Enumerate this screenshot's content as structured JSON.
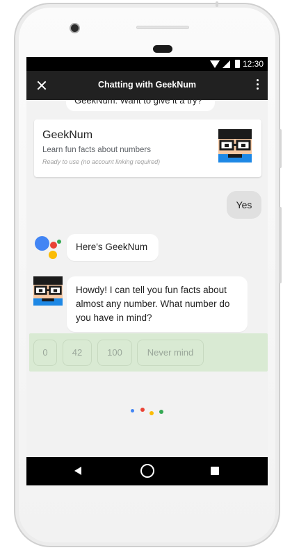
{
  "status_bar": {
    "time": "12:30"
  },
  "app_bar": {
    "title": "Chatting with GeekNum"
  },
  "messages": {
    "previous_bot_partial": "GeekNum: Want to give it a try?",
    "user_reply": "Yes",
    "assistant_intro": "Here's GeekNum",
    "bot_greeting": "Howdy! I can tell you fun facts about almost any number. What number do you have in mind?"
  },
  "app_card": {
    "name": "GeekNum",
    "description": "Learn fun facts about numbers",
    "status": "Ready to use (no account linking required)"
  },
  "suggestions": [
    "0",
    "42",
    "100",
    "Never mind"
  ],
  "colors": {
    "google_blue": "#4285F4",
    "google_red": "#EA4335",
    "google_yellow": "#FBBC05",
    "google_green": "#34A853",
    "suggestion_bg": "#D9EAD3"
  }
}
